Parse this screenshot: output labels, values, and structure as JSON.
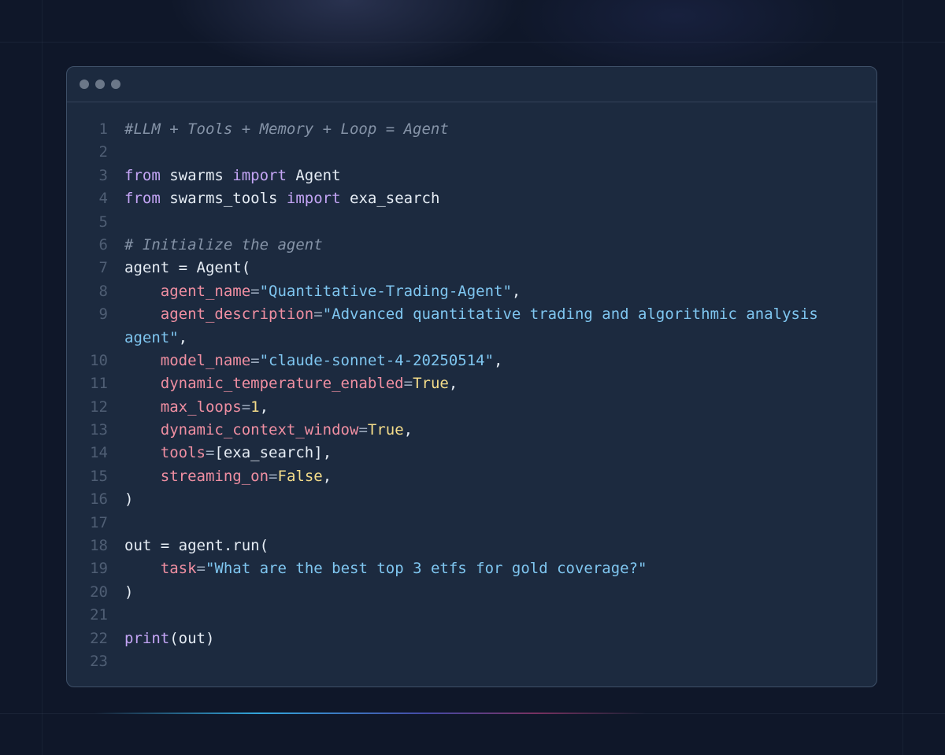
{
  "window": {
    "controls": [
      "close",
      "minimize",
      "maximize"
    ]
  },
  "code": {
    "line_numbers": [
      "1",
      "2",
      "3",
      "4",
      "5",
      "6",
      "7",
      "8",
      "9",
      "10",
      "11",
      "12",
      "13",
      "14",
      "15",
      "16",
      "17",
      "18",
      "19",
      "20",
      "21",
      "22",
      "23"
    ],
    "l1": "#LLM + Tools + Memory + Loop = Agent",
    "l3": {
      "kw1": "from",
      "mod": " swarms ",
      "kw2": "import",
      "name": " Agent"
    },
    "l4": {
      "kw1": "from",
      "mod": " swarms_tools ",
      "kw2": "import",
      "name": " exa_search"
    },
    "l6": "# Initialize the agent",
    "l7": "agent = Agent(",
    "l8": {
      "param": "agent_name",
      "value": "\"Quantitative-Trading-Agent\""
    },
    "l9": {
      "param": "agent_description",
      "value": "\"Advanced quantitative trading and algorithmic analysis",
      "cont": "agent\""
    },
    "l10": {
      "param": "model_name",
      "value": "\"claude-sonnet-4-20250514\""
    },
    "l11": {
      "param": "dynamic_temperature_enabled",
      "value": "True"
    },
    "l12": {
      "param": "max_loops",
      "value": "1"
    },
    "l13": {
      "param": "dynamic_context_window",
      "value": "True"
    },
    "l14": {
      "param": "tools",
      "value": "[exa_search]"
    },
    "l15": {
      "param": "streaming_on",
      "value": "False"
    },
    "l16": ")",
    "l18": "out = agent.run(",
    "l19": {
      "param": "task",
      "value": "\"What are the best top 3 etfs for gold coverage?\""
    },
    "l20": ")",
    "l22": {
      "fn": "print",
      "args": "(out)"
    }
  },
  "colors": {
    "background": "#0f1729",
    "panel": "#1c2a3f",
    "keyword": "#c4a5f5",
    "parameter": "#f08fa2",
    "string": "#7fc6f0",
    "constant": "#f5dd8a",
    "comment": "#8593a7"
  }
}
